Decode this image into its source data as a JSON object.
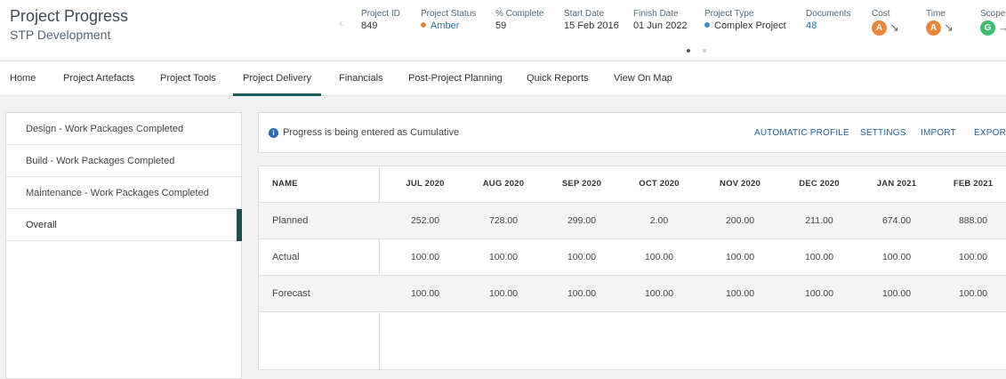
{
  "header": {
    "title": "Project Progress",
    "subtitle": "STP Development",
    "meta": [
      {
        "label": "Project ID",
        "value": "849"
      },
      {
        "label": "Project Status",
        "value": "Amber",
        "dot_color": "#e6873c"
      },
      {
        "label": "% Complete",
        "value": "59"
      },
      {
        "label": "Start Date",
        "value": "15 Feb 2016"
      },
      {
        "label": "Finish Date",
        "value": "01 Jun 2022"
      },
      {
        "label": "Project Type",
        "value": "Complex Project",
        "dot_color": "#3f8fd1"
      },
      {
        "label": "Documents",
        "value": "48"
      },
      {
        "label": "Cost",
        "badge": "A",
        "badge_color": "#e6873c"
      },
      {
        "label": "Time",
        "badge": "A",
        "badge_color": "#e6873c"
      },
      {
        "label": "Scope",
        "badge": "G",
        "badge_color": "#3cbf6a"
      }
    ]
  },
  "tabs": [
    "Home",
    "Project Artefacts",
    "Project Tools",
    "Project Delivery",
    "Financials",
    "Post-Project Planning",
    "Quick Reports",
    "View On Map"
  ],
  "active_tab": "Project Delivery",
  "left_list": [
    "Design - Work Packages Completed",
    "Build - Work Packages Completed",
    "Maintenance - Work Packages Completed",
    "Overall"
  ],
  "info": {
    "text": "Progress is being entered as Cumulative",
    "actions": [
      "AUTOMATIC PROFILE",
      "SETTINGS",
      "IMPORT",
      "EXPORT"
    ]
  },
  "table": {
    "columns": [
      "NAME",
      "JUL 2020",
      "AUG 2020",
      "SEP 2020",
      "OCT 2020",
      "NOV 2020",
      "DEC 2020",
      "JAN 2021",
      "FEB 2021"
    ],
    "rows": [
      {
        "name": "Planned",
        "values": [
          "252.00",
          "728.00",
          "299.00",
          "2.00",
          "200.00",
          "211.00",
          "674.00",
          "888.00"
        ]
      },
      {
        "name": "Actual",
        "values": [
          "100.00",
          "100.00",
          "100.00",
          "100.00",
          "100.00",
          "100.00",
          "100.00",
          "100.00"
        ]
      },
      {
        "name": "Forecast",
        "values": [
          "100.00",
          "100.00",
          "100.00",
          "100.00",
          "100.00",
          "100.00",
          "100.00",
          "100.00"
        ]
      }
    ]
  }
}
